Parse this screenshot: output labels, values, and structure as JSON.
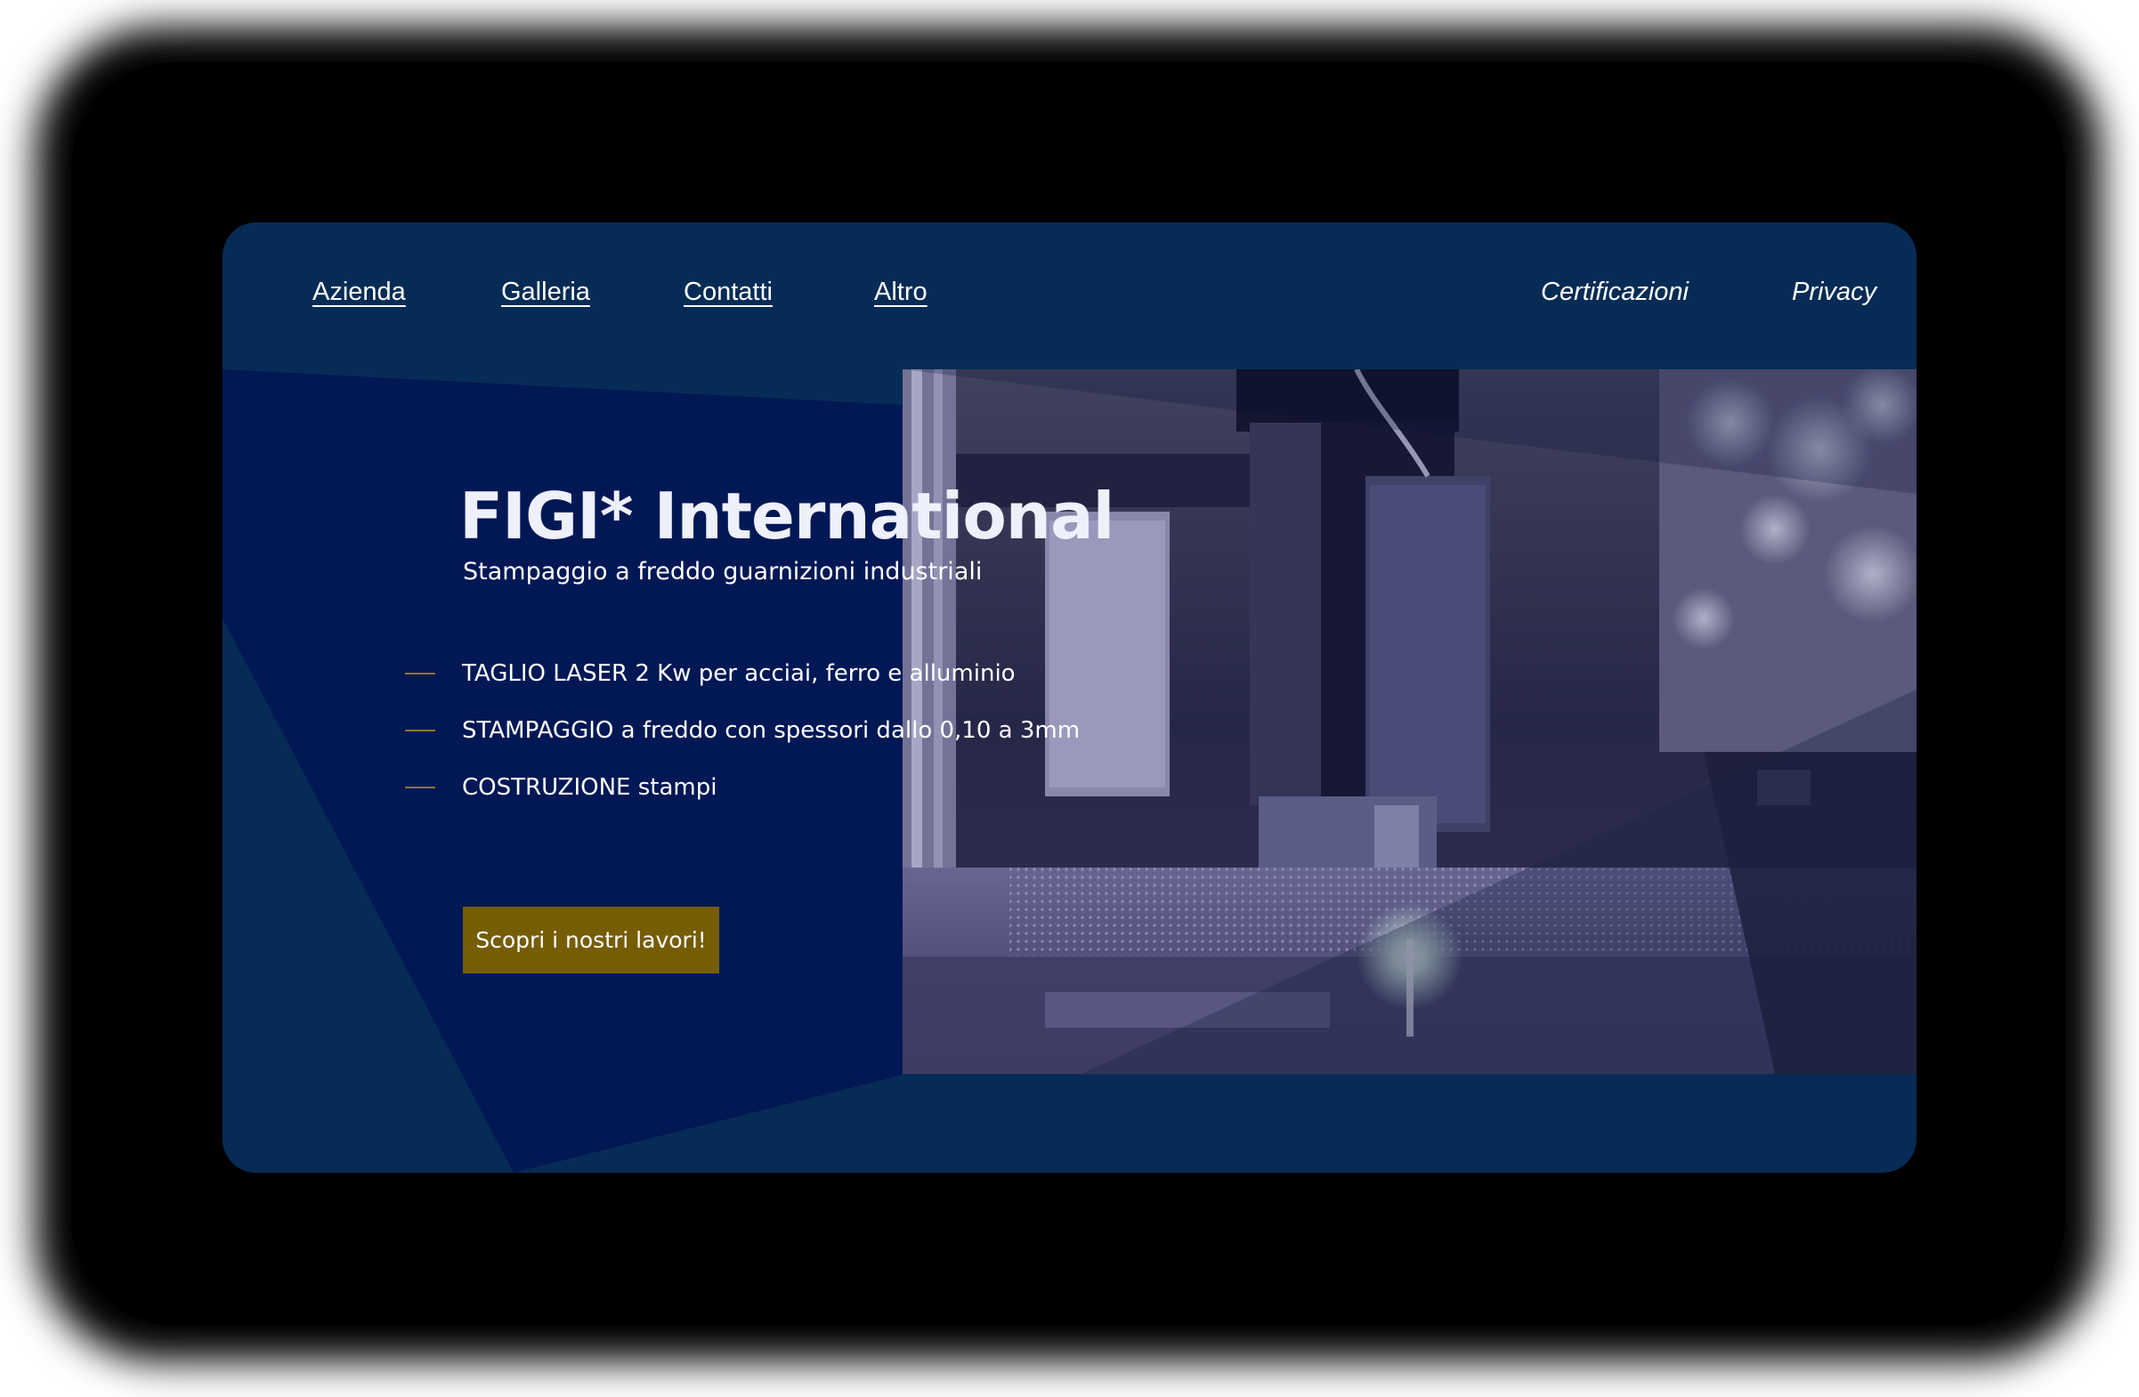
{
  "nav": {
    "left": [
      "Azienda",
      "Galleria",
      "Contatti",
      "Altro"
    ],
    "right": [
      "Certificazioni",
      "Privacy"
    ]
  },
  "hero": {
    "title": "FIGI* International",
    "subtitle": "Stampaggio a freddo guarnizioni industriali",
    "features": [
      "TAGLIO LASER 2 Kw per acciai, ferro e alluminio",
      "STAMPAGGIO a freddo con spessori dallo 0,10 a 3mm",
      "COSTRUZIONE stampi"
    ],
    "cta_label": "Scopri i nostri lavori!",
    "image": "laser-cutting-machine-photo"
  },
  "colors": {
    "card_background": "#062c55",
    "panel_navy": "#011855",
    "accent_gold": "#765c04",
    "text": "#ffffff"
  }
}
